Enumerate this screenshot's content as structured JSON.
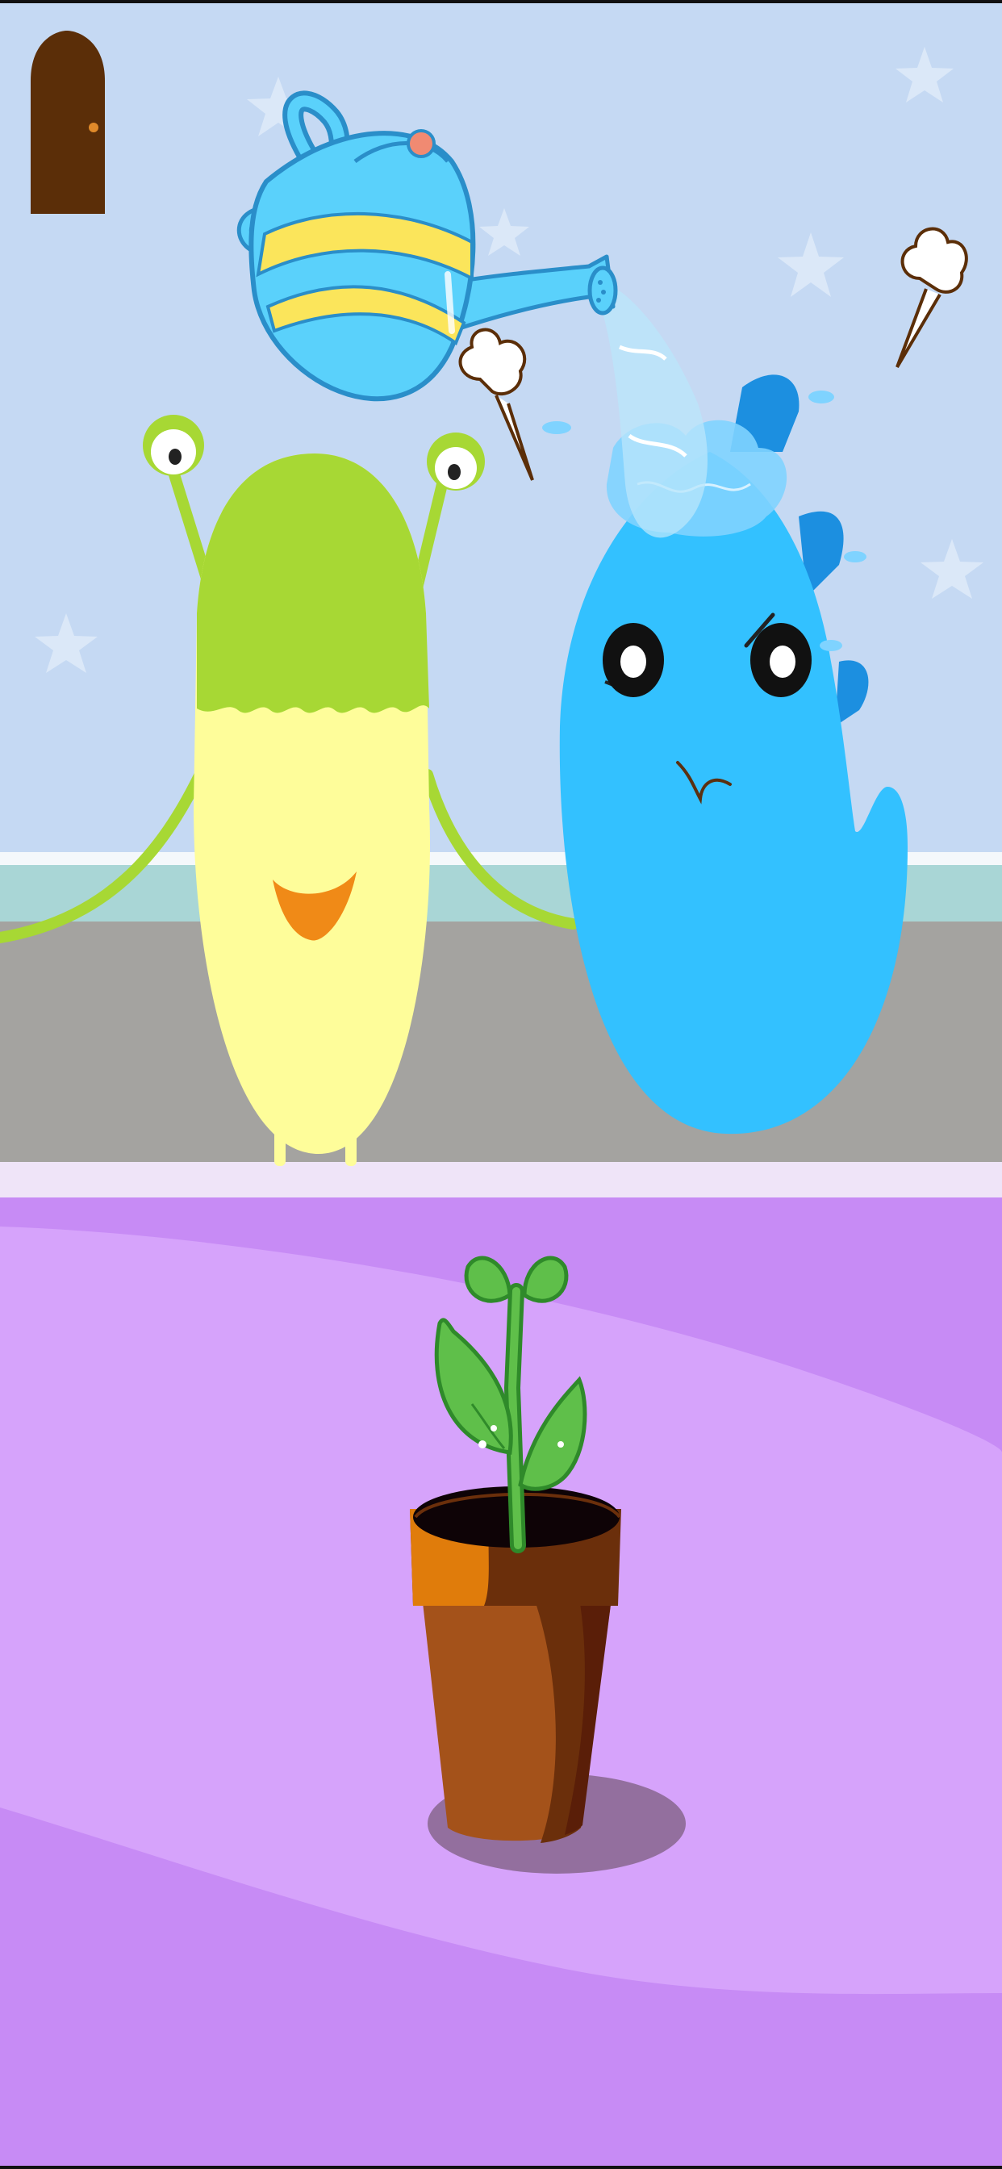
{
  "game": {
    "scene": "watering-plant",
    "colors": {
      "wall": "#c5d9f3",
      "wall_star": "#dbe8f8",
      "baseboard_white": "#f4f8fb",
      "baseboard_teal": "#a9d6d6",
      "floor_back": "#a4a3a0",
      "floor_edge": "#efe4f8",
      "floor_purple": "#c78bf5",
      "rug": "#d6a3fb",
      "door": "#5b2e08",
      "door_knob": "#e08a2a",
      "green_monster_top": "#a7d834",
      "green_monster_body": "#fefd9a",
      "green_monster_mouth": "#f08a17",
      "blue_monster": "#33c1ff",
      "blue_monster_dark": "#1c8fe0",
      "kettle": "#5ad1fb",
      "kettle_stripe": "#fbe55b",
      "water": "#b9e6fb",
      "pot_rim": "#e07c0b",
      "pot_body": "#a4521a",
      "pot_dark": "#6b2f0b",
      "leaf": "#5fbf4a",
      "leaf_dark": "#2f8a2a",
      "shadow": "#936f9e"
    },
    "elements": {
      "door": "exit-door",
      "watering_can": "watering-can",
      "green_monster": "green-monster",
      "blue_monster": "blue-monster",
      "plant": "sprout-in-pot"
    }
  }
}
